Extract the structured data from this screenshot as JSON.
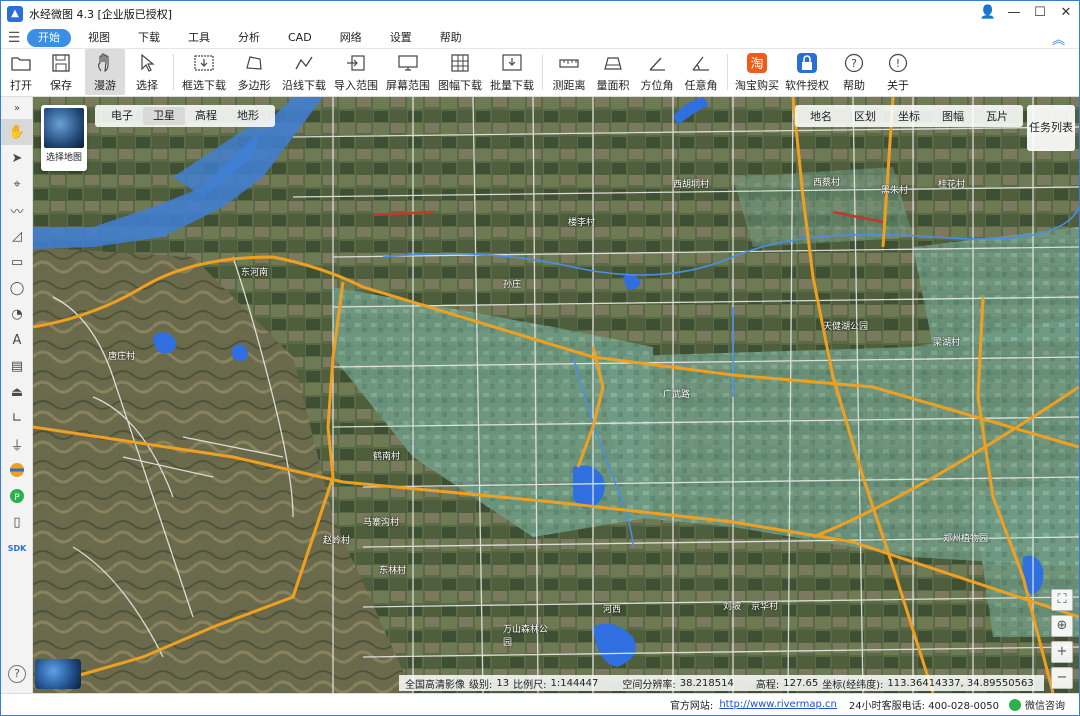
{
  "window": {
    "title": "水经微图 4.3 [企业版已授权]",
    "controls": {
      "user": "👤",
      "min": "—",
      "max": "☐",
      "close": "✕"
    }
  },
  "menu": {
    "items": [
      {
        "label": "开始",
        "active": true
      },
      {
        "label": "视图"
      },
      {
        "label": "下载"
      },
      {
        "label": "工具"
      },
      {
        "label": "分析"
      },
      {
        "label": "CAD"
      },
      {
        "label": "网络"
      },
      {
        "label": "设置"
      },
      {
        "label": "帮助"
      }
    ]
  },
  "toolbar": {
    "open": "打开",
    "save": "保存",
    "pan": "漫游",
    "select": "选择",
    "box_download": "框选下载",
    "polygon": "多边形",
    "line_download": "沿线下载",
    "import_range": "导入范围",
    "screen_range": "屏幕范围",
    "sheet_download": "图幅下载",
    "batch_download": "批量下载",
    "measure_distance": "测距离",
    "measure_area": "量面积",
    "azimuth": "方位角",
    "any_angle": "任意角",
    "taobao": "淘宝购买",
    "license": "软件授权",
    "help": "帮助",
    "about": "关于"
  },
  "left_tools": {
    "expand": "»",
    "sdk": "SDK",
    "help": "?"
  },
  "map": {
    "layer_picker_label": "选择地图",
    "map_types": [
      {
        "label": "电子"
      },
      {
        "label": "卫星",
        "active": true
      },
      {
        "label": "高程"
      },
      {
        "label": "地形"
      }
    ],
    "overlays": [
      {
        "label": "地名"
      },
      {
        "label": "区划"
      },
      {
        "label": "坐标"
      },
      {
        "label": "图幅"
      },
      {
        "label": "瓦片"
      }
    ],
    "task_list": "任务列表",
    "zoom": {
      "fullscreen": "⛶",
      "locate": "⊕",
      "in": "+",
      "out": "−"
    },
    "labels": {
      "l1": "东河南",
      "l2": "鹤南村",
      "l3": "马寨沟村",
      "l4": "赵岭村",
      "l5": "东林村",
      "l6": "万山森林公园",
      "l7": "河西",
      "l8": "郑州植物园",
      "l9": "天健湖公园",
      "l10": "广武路",
      "l11": "西胡垌村",
      "l12": "楼李村",
      "l13": "黑朱村",
      "l14": "桂花村",
      "l15": "刘坡",
      "l16": "京华村",
      "l17": "西蔡村",
      "l18": "梁湖村",
      "l19": "孙庄",
      "l20": "唐庄村"
    },
    "status": {
      "source": "全国高清影像",
      "level_label": "级别:",
      "level": "13",
      "scale_label": "比例尺:",
      "scale": "1:144447",
      "resolution_label": "空间分辨率:",
      "resolution": "38.218514",
      "elev_label": "高程:",
      "elev": "127.65",
      "coord_label": "坐标(经纬度):",
      "coord": "113.36414337, 34.89550563"
    }
  },
  "statusbar": {
    "site_label": "官方网站:",
    "site_url": "http://www.rivermap.cn",
    "hotline": "24小时客服电话: 400-028-0050",
    "wechat": "微信咨询"
  }
}
